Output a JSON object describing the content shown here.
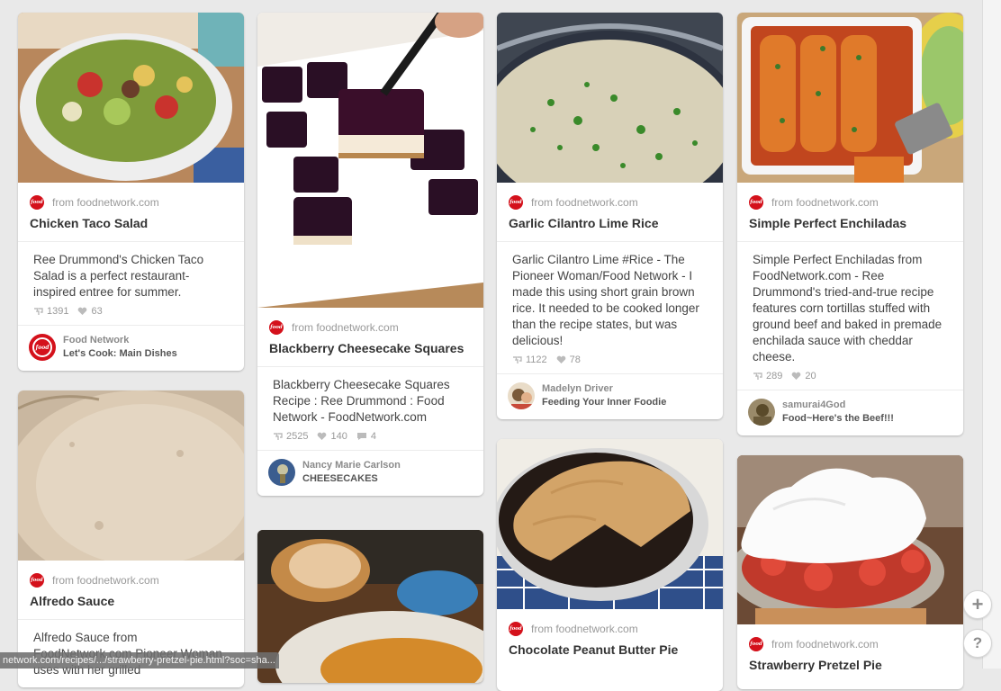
{
  "pins": [
    {
      "source": "from foodnetwork.com",
      "title": "Chicken Taco Salad",
      "description": "Ree Drummond's Chicken Taco Salad is a perfect restaurant-inspired entree for summer.",
      "repins": "1391",
      "likes": "63",
      "pinner_name": "Food Network",
      "board": "Let's Cook: Main Dishes"
    },
    {
      "source": "from foodnetwork.com",
      "title": "Blackberry Cheesecake Squares",
      "description": "Blackberry Cheesecake Squares Recipe : Ree Drummond : Food Network - FoodNetwork.com",
      "repins": "2525",
      "likes": "140",
      "comments": "4",
      "pinner_name": "Nancy Marie Carlson",
      "board": "CHEESECAKES"
    },
    {
      "source": "from foodnetwork.com",
      "title": "Garlic Cilantro Lime Rice",
      "description": "Garlic Cilantro Lime #Rice - The Pioneer Woman/Food Network - I made this using short grain brown rice. It needed to be cooked longer than the recipe states, but was delicious!",
      "repins": "1122",
      "likes": "78",
      "pinner_name": "Madelyn Driver",
      "board": "Feeding Your Inner Foodie"
    },
    {
      "source": "from foodnetwork.com",
      "title": "Simple Perfect Enchiladas",
      "description": "Simple Perfect Enchiladas from FoodNetwork.com - Ree Drummond's tried-and-true recipe features corn tortillas stuffed with ground beef and baked in premade enchilada sauce with cheddar cheese.",
      "repins": "289",
      "likes": "20",
      "pinner_name": "samurai4God",
      "board": "Food~Here's the Beef!!!"
    },
    {
      "source": "from foodnetwork.com",
      "title": "Alfredo Sauce",
      "description": "Alfredo Sauce from FoodNetwork.com Pioneer Woman uses with her grilled"
    },
    {
      "source": "from foodnetwork.com",
      "title": "Chocolate Peanut Butter Pie"
    },
    {
      "source": "from foodnetwork.com",
      "title": "Strawberry Pretzel Pie"
    }
  ],
  "logo_text": "food",
  "buttons": {
    "add": "+",
    "help": "?"
  },
  "status_bar": {
    "url": "network.com/recipes/.../strawberry-pretzel-pie.html?soc=sha..."
  },
  "colors": {
    "brand_red": "#d4111b",
    "background": "#e9e9e9",
    "card": "#ffffff"
  }
}
